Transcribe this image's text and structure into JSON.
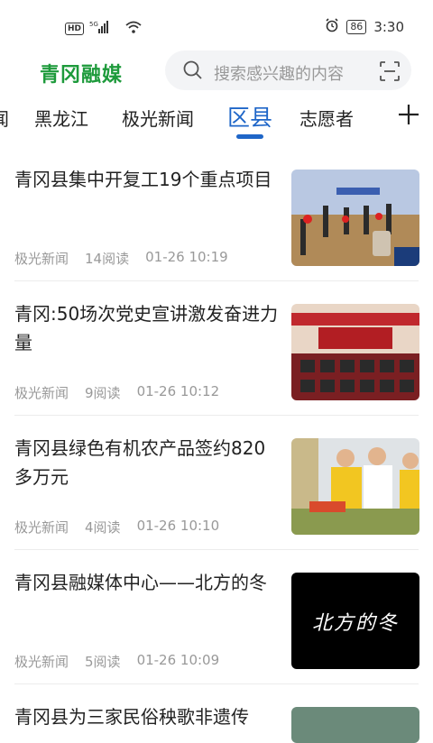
{
  "status_bar": {
    "left_badge": "HD",
    "network": "5G",
    "battery": "86",
    "time": "3:30"
  },
  "header": {
    "logo": "青冈融媒",
    "search_placeholder": "搜索感兴趣的内容"
  },
  "tabs": [
    {
      "label": "闻"
    },
    {
      "label": "黑龙江"
    },
    {
      "label": "极光新闻"
    },
    {
      "label": "区县"
    },
    {
      "label": "志愿者"
    }
  ],
  "active_tab": "区县",
  "feed": [
    {
      "title": "青冈县集中开复工19个重点项目",
      "source": "极光新闻",
      "reads": "14阅读",
      "time": "01-26 10:19"
    },
    {
      "title": "青冈:50场次党史宣讲激发奋进力量",
      "source": "极光新闻",
      "reads": "9阅读",
      "time": "01-26 10:12"
    },
    {
      "title": "青冈县绿色有机农产品签约820多万元",
      "source": "极光新闻",
      "reads": "4阅读",
      "time": "01-26 10:10"
    },
    {
      "title": "青冈县融媒体中心——北方的冬",
      "source": "极光新闻",
      "reads": "5阅读",
      "time": "01-26 10:09",
      "thumb_text": "北方的冬"
    },
    {
      "title": "青冈县为三家民俗秧歌非遗传"
    }
  ],
  "colors": {
    "brand_green": "#1d9a3b",
    "accent_blue": "#1f66c8"
  }
}
